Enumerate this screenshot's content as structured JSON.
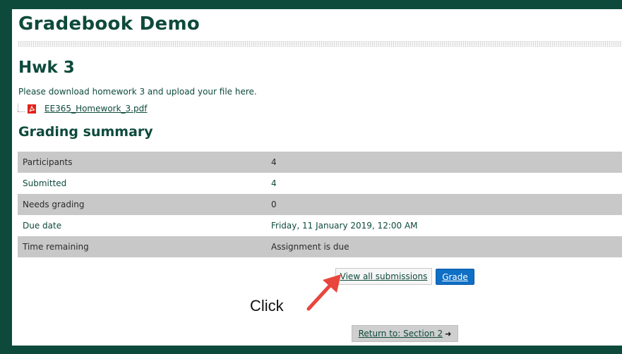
{
  "site": {
    "title": "Gradebook Demo"
  },
  "assignment": {
    "title": "Hwk 3",
    "intro": "Please download homework 3 and upload your file here.",
    "file": {
      "name": "EE365_Homework_3.pdf",
      "icon": "pdf-icon"
    }
  },
  "summary": {
    "heading": "Grading summary",
    "rows": [
      {
        "label": "Participants",
        "value": "4"
      },
      {
        "label": "Submitted",
        "value": "4"
      },
      {
        "label": "Needs grading",
        "value": "0"
      },
      {
        "label": "Due date",
        "value": "Friday, 11 January 2019, 12:00 AM"
      },
      {
        "label": "Time remaining",
        "value": "Assignment is due"
      }
    ]
  },
  "actions": {
    "view_all_label": "View all submissions",
    "grade_label": "Grade",
    "return_label": "Return to: Section 2"
  },
  "annotation": {
    "label": "Click",
    "color": "#e8453c"
  },
  "colors": {
    "brand": "#0e4a3b",
    "grade_button": "#0f6fc5",
    "row_shade": "#c8c8c8"
  }
}
